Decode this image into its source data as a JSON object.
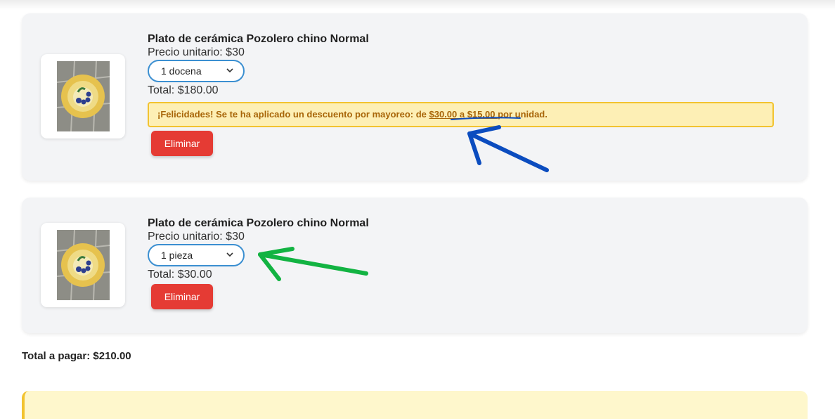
{
  "cart": {
    "items": [
      {
        "name": "Plato de cerámica Pozolero chino Normal",
        "unit_price": "Precio unitario: $30",
        "quantity": "1 docena",
        "total": "Total: $180.00",
        "discount": {
          "prefix": "¡Felicidades! Se te ha aplicado un descuento por mayoreo: de ",
          "range": "$30.00 a $15.00 ",
          "suffix": "por unidad."
        },
        "remove_label": "Eliminar"
      },
      {
        "name": "Plato de cerámica Pozolero chino Normal",
        "unit_price": "Precio unitario: $30",
        "quantity": "1 pieza",
        "total": "Total: $30.00",
        "remove_label": "Eliminar"
      }
    ],
    "grand_total": "Total a pagar: $210.00"
  },
  "annotations": {
    "blue_arrow_color": "#0b4cbf",
    "green_arrow_color": "#12b342"
  }
}
